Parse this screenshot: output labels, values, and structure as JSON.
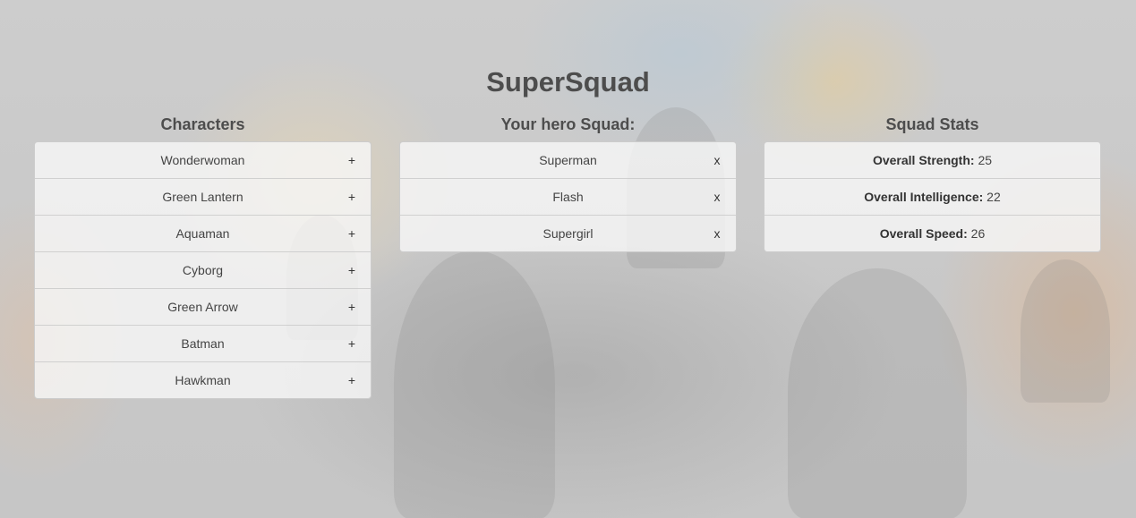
{
  "app": {
    "title": "SuperSquad"
  },
  "characters": {
    "heading": "Characters",
    "add_symbol": "+",
    "items": [
      {
        "name": "Wonderwoman"
      },
      {
        "name": "Green Lantern"
      },
      {
        "name": "Aquaman"
      },
      {
        "name": "Cyborg"
      },
      {
        "name": "Green Arrow"
      },
      {
        "name": "Batman"
      },
      {
        "name": "Hawkman"
      }
    ]
  },
  "squad": {
    "heading": "Your hero Squad:",
    "remove_symbol": "x",
    "items": [
      {
        "name": "Superman"
      },
      {
        "name": "Flash"
      },
      {
        "name": "Supergirl"
      }
    ]
  },
  "stats": {
    "heading": "Squad Stats",
    "items": [
      {
        "label": "Overall Strength:",
        "value": "25"
      },
      {
        "label": "Overall Intelligence:",
        "value": "22"
      },
      {
        "label": "Overall Speed:",
        "value": "26"
      }
    ]
  }
}
